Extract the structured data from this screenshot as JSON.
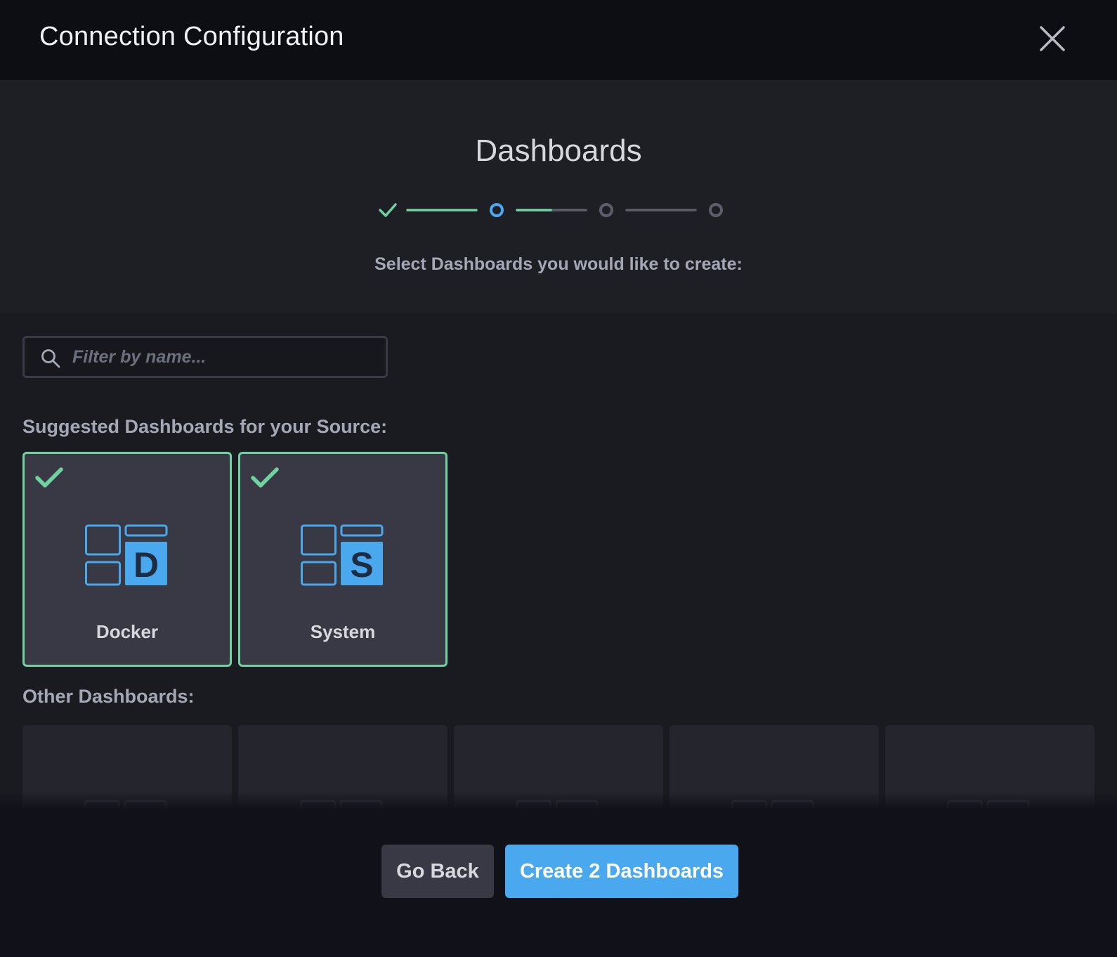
{
  "header": {
    "title": "Connection Configuration",
    "close_icon": "close-icon"
  },
  "step": {
    "title": "Dashboards",
    "subtitle": "Select Dashboards you would like to create:",
    "steps": [
      {
        "state": "complete"
      },
      {
        "state": "current"
      },
      {
        "state": "pending"
      },
      {
        "state": "pending"
      }
    ],
    "connector_progress": [
      1.0,
      0.5,
      0.0
    ],
    "colors": {
      "complete": "#6fd2a0",
      "current": "#4aa8ef",
      "pending": "#5c5f6b"
    }
  },
  "search": {
    "placeholder": "Filter by name...",
    "value": "",
    "icon": "search-icon"
  },
  "suggested": {
    "label": "Suggested Dashboards for your Source:",
    "items": [
      {
        "name": "Docker",
        "letter": "D",
        "selected": true
      },
      {
        "name": "System",
        "letter": "S",
        "selected": true
      }
    ]
  },
  "other": {
    "label": "Other Dashboards:",
    "count_visible": 5
  },
  "footer": {
    "back_label": "Go Back",
    "create_label": "Create 2 Dashboards"
  },
  "colors": {
    "accent_green": "#6fd2a0",
    "accent_blue": "#4aa8ef",
    "icon_blue": "#4aa8ef"
  }
}
